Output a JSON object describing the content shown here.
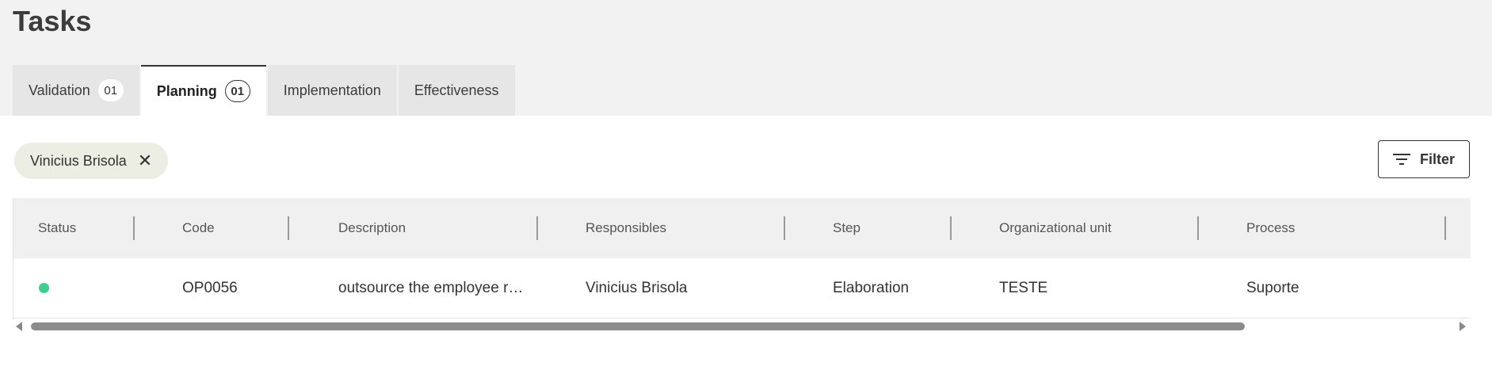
{
  "page": {
    "title": "Tasks"
  },
  "tabs": [
    {
      "label": "Validation",
      "count": "01",
      "active": false
    },
    {
      "label": "Planning",
      "count": "01",
      "active": true
    },
    {
      "label": "Implementation",
      "active": false
    },
    {
      "label": "Effectiveness",
      "active": false
    }
  ],
  "filter_chip": {
    "label": "Vinicius Brisola",
    "close_glyph": "✕"
  },
  "filter_button": {
    "label": "Filter",
    "icon": "filter-lines-icon"
  },
  "table": {
    "columns": [
      "Status",
      "Code",
      "Description",
      "Responsibles",
      "Step",
      "Organizational unit",
      "Process"
    ],
    "rows": [
      {
        "status_color": "#3ecf8e",
        "code": "OP0056",
        "description": "outsource the employee re...",
        "responsibles": "Vinicius Brisola",
        "step": "Elaboration",
        "organizational_unit": "TESTE",
        "process": "Suporte"
      }
    ]
  },
  "colors": {
    "accent": "#333333",
    "chip_bg": "#ecede3",
    "status_green": "#3ecf8e"
  }
}
